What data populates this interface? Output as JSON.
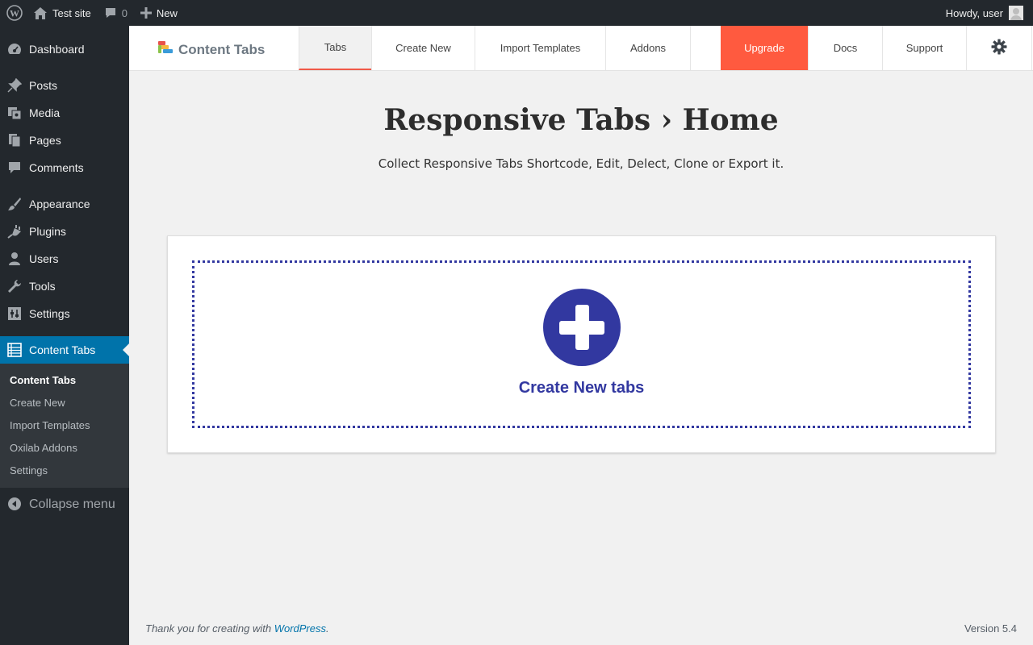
{
  "adminbar": {
    "site_name": "Test site",
    "comments_count": "0",
    "new_label": "New",
    "howdy": "Howdy, user"
  },
  "sidebar": {
    "items": [
      {
        "label": "Dashboard",
        "icon": "dashboard-icon"
      },
      {
        "label": "Posts",
        "icon": "pin-icon"
      },
      {
        "label": "Media",
        "icon": "media-icon"
      },
      {
        "label": "Pages",
        "icon": "pages-icon"
      },
      {
        "label": "Comments",
        "icon": "comment-icon"
      },
      {
        "label": "Appearance",
        "icon": "brush-icon"
      },
      {
        "label": "Plugins",
        "icon": "plugin-icon"
      },
      {
        "label": "Users",
        "icon": "user-icon"
      },
      {
        "label": "Tools",
        "icon": "wrench-icon"
      },
      {
        "label": "Settings",
        "icon": "settings-icon"
      },
      {
        "label": "Content Tabs",
        "icon": "list-icon"
      }
    ],
    "submenu": [
      "Content Tabs",
      "Create New",
      "Import Templates",
      "Oxilab Addons",
      "Settings"
    ],
    "collapse_label": "Collapse menu"
  },
  "topnav": {
    "brand": "Content Tabs",
    "tabs": [
      "Tabs",
      "Create New",
      "Import Templates",
      "Addons",
      "Upgrade",
      "Docs",
      "Support"
    ],
    "active_tab": "Tabs",
    "accent_color": "#ff5a3f"
  },
  "main": {
    "title": "Responsive Tabs › Home",
    "subtitle": "Collect Responsive Tabs Shortcode, Edit, Delect, Clone or Export it.",
    "create_label": "Create New tabs",
    "accent_color": "#3238a0"
  },
  "footer": {
    "thanks_prefix": "Thank you for creating with ",
    "thanks_link": "WordPress",
    "thanks_suffix": ".",
    "version": "Version 5.4"
  }
}
